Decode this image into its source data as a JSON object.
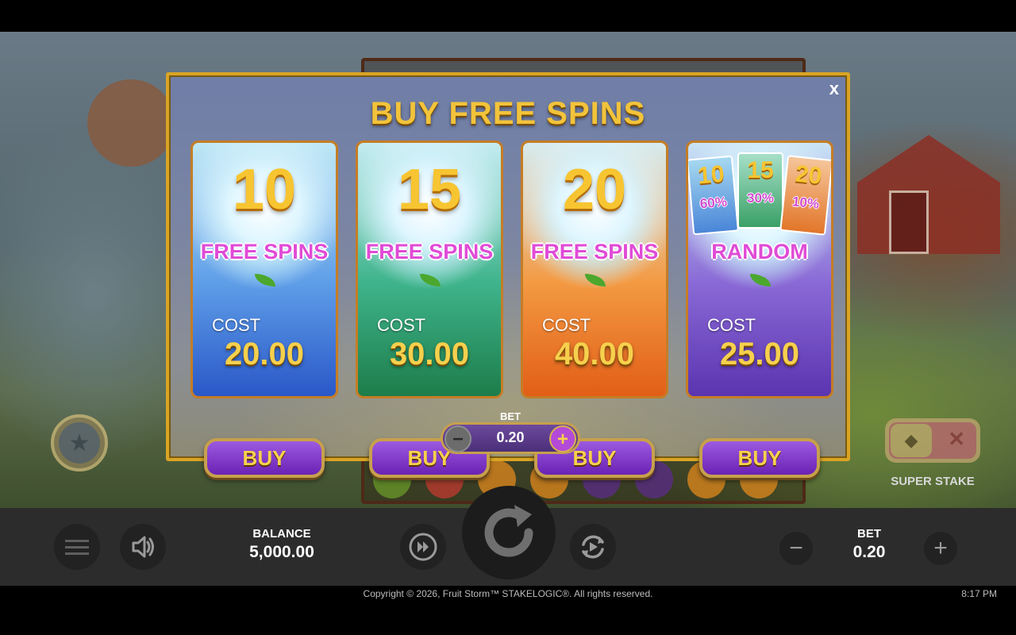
{
  "modal": {
    "title": "BUY FREE SPINS",
    "close_label": "x",
    "cards": [
      {
        "big_number": "10",
        "label": "FREE SPINS",
        "cost_label": "COST",
        "cost": "20.00",
        "buy_label": "BUY"
      },
      {
        "big_number": "15",
        "label": "FREE SPINS",
        "cost_label": "COST",
        "cost": "30.00",
        "buy_label": "BUY"
      },
      {
        "big_number": "20",
        "label": "FREE SPINS",
        "cost_label": "COST",
        "cost": "40.00",
        "buy_label": "BUY"
      },
      {
        "label": "RANDOM",
        "cost_label": "COST",
        "cost": "25.00",
        "buy_label": "BUY",
        "options": [
          {
            "spins": "10",
            "chance": "60%"
          },
          {
            "spins": "15",
            "chance": "30%"
          },
          {
            "spins": "20",
            "chance": "10%"
          }
        ]
      }
    ],
    "bet": {
      "label": "BET",
      "value": "0.20",
      "minus": "−",
      "plus": "+"
    }
  },
  "super_stake": {
    "label": "SUPER STAKE",
    "diamond_icon": "◆",
    "off_icon": "✕"
  },
  "bottom_bar": {
    "balance_label": "BALANCE",
    "balance_value": "5,000.00",
    "bet_label": "BET",
    "bet_value": "0.20",
    "minus": "−",
    "plus": "+"
  },
  "footer": {
    "copyright": "Copyright © 2026, Fruit Storm™ STAKELOGIC®. All rights reserved.",
    "time": "8:17 PM"
  },
  "colors": {
    "modal_border": "#d9a424",
    "title_gold": "#f2c33b",
    "buy_purple": "#7a34c4",
    "spins_pink": "#e04bd6"
  }
}
